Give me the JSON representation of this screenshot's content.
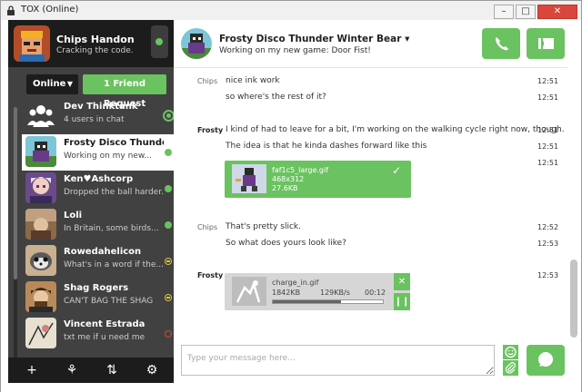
{
  "window": {
    "title": "TOX (Online)",
    "min_glyph": "–",
    "max_glyph": "□",
    "close_glyph": "✕"
  },
  "self": {
    "name": "Chips Handon",
    "status_message": "Cracking the code.",
    "status": "online"
  },
  "filter": {
    "selected": "Online",
    "caret": "▼",
    "friend_requests_label": "1 Friend Request"
  },
  "friends": [
    {
      "name": "Dev Thinktank",
      "status": "4 users in chat",
      "presence": "group"
    },
    {
      "name": "Frosty Disco Thunder...",
      "status": "Working on my new...",
      "presence": "online",
      "active": true
    },
    {
      "name": "Ken♥Ashcorp",
      "status": "Dropped the ball harder...",
      "presence": "online"
    },
    {
      "name": "Loli",
      "status": "In Britain, some birds...",
      "presence": "online"
    },
    {
      "name": "Rowedahelicon",
      "status": "What's in a word if the...",
      "presence": "away"
    },
    {
      "name": "Shag Rogers",
      "status": "CAN'T BAG THE SHAG",
      "presence": "away"
    },
    {
      "name": "Vincent Estrada",
      "status": "txt me if u need me",
      "presence": "busy"
    }
  ],
  "bottom_bar": {
    "add_glyph": "+",
    "group_glyph": "⚘",
    "transfers_glyph": "⇅",
    "settings_glyph": "⚙"
  },
  "chat": {
    "name": "Frosty Disco Thunder Winter Bear",
    "caret": "▾",
    "status": "Working on my new game: Door Fist!"
  },
  "messages": [
    {
      "author": "Chips",
      "text": "nice ink work",
      "time": "12:51"
    },
    {
      "author": "",
      "text": "so where's the rest of it?",
      "time": "12:51"
    },
    {
      "author": "Frosty",
      "text": "I kind of had to leave for a bit, I'm working on the walking cycle right now, though.",
      "time": "12:51"
    },
    {
      "author": "",
      "text": "The idea is that he kinda dashes forward like this",
      "time": "12:51"
    },
    {
      "author": "",
      "text": "",
      "time": "12:51"
    },
    {
      "author": "Chips",
      "text": "That's pretty slick.",
      "time": "12:52"
    },
    {
      "author": "",
      "text": "So what does yours look like?",
      "time": "12:53"
    },
    {
      "author": "Frosty",
      "text": "",
      "time": "12:53"
    }
  ],
  "transfer_done": {
    "filename": "faf1c5_large.gif",
    "dimensions": "468x312",
    "size": "27.6KB",
    "check_glyph": "✓"
  },
  "transfer_active": {
    "filename": "charge_in.gif",
    "size": "1842KB",
    "speed": "129KB/s",
    "eta": "00:12",
    "progress": 0.62,
    "cancel_glyph": "✕",
    "pause_glyph": "❙❙"
  },
  "composer": {
    "placeholder": "Type your message here..."
  },
  "colors": {
    "accent": "#6bc260",
    "sidebar_bg": "#414141",
    "sidebar_dark": "#1c1c1c",
    "away": "#d6c43a",
    "busy": "#d9463b"
  }
}
